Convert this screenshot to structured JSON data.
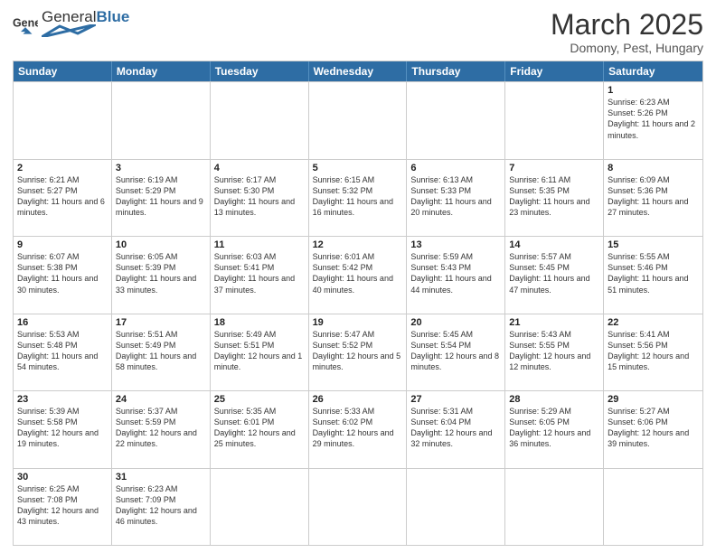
{
  "header": {
    "logo_general": "General",
    "logo_blue": "Blue",
    "month_title": "March 2025",
    "location": "Domony, Pest, Hungary"
  },
  "weekdays": [
    "Sunday",
    "Monday",
    "Tuesday",
    "Wednesday",
    "Thursday",
    "Friday",
    "Saturday"
  ],
  "weeks": [
    [
      {
        "day": "",
        "info": ""
      },
      {
        "day": "",
        "info": ""
      },
      {
        "day": "",
        "info": ""
      },
      {
        "day": "",
        "info": ""
      },
      {
        "day": "",
        "info": ""
      },
      {
        "day": "",
        "info": ""
      },
      {
        "day": "1",
        "info": "Sunrise: 6:23 AM\nSunset: 5:26 PM\nDaylight: 11 hours and 2 minutes."
      }
    ],
    [
      {
        "day": "2",
        "info": "Sunrise: 6:21 AM\nSunset: 5:27 PM\nDaylight: 11 hours and 6 minutes."
      },
      {
        "day": "3",
        "info": "Sunrise: 6:19 AM\nSunset: 5:29 PM\nDaylight: 11 hours and 9 minutes."
      },
      {
        "day": "4",
        "info": "Sunrise: 6:17 AM\nSunset: 5:30 PM\nDaylight: 11 hours and 13 minutes."
      },
      {
        "day": "5",
        "info": "Sunrise: 6:15 AM\nSunset: 5:32 PM\nDaylight: 11 hours and 16 minutes."
      },
      {
        "day": "6",
        "info": "Sunrise: 6:13 AM\nSunset: 5:33 PM\nDaylight: 11 hours and 20 minutes."
      },
      {
        "day": "7",
        "info": "Sunrise: 6:11 AM\nSunset: 5:35 PM\nDaylight: 11 hours and 23 minutes."
      },
      {
        "day": "8",
        "info": "Sunrise: 6:09 AM\nSunset: 5:36 PM\nDaylight: 11 hours and 27 minutes."
      }
    ],
    [
      {
        "day": "9",
        "info": "Sunrise: 6:07 AM\nSunset: 5:38 PM\nDaylight: 11 hours and 30 minutes."
      },
      {
        "day": "10",
        "info": "Sunrise: 6:05 AM\nSunset: 5:39 PM\nDaylight: 11 hours and 33 minutes."
      },
      {
        "day": "11",
        "info": "Sunrise: 6:03 AM\nSunset: 5:41 PM\nDaylight: 11 hours and 37 minutes."
      },
      {
        "day": "12",
        "info": "Sunrise: 6:01 AM\nSunset: 5:42 PM\nDaylight: 11 hours and 40 minutes."
      },
      {
        "day": "13",
        "info": "Sunrise: 5:59 AM\nSunset: 5:43 PM\nDaylight: 11 hours and 44 minutes."
      },
      {
        "day": "14",
        "info": "Sunrise: 5:57 AM\nSunset: 5:45 PM\nDaylight: 11 hours and 47 minutes."
      },
      {
        "day": "15",
        "info": "Sunrise: 5:55 AM\nSunset: 5:46 PM\nDaylight: 11 hours and 51 minutes."
      }
    ],
    [
      {
        "day": "16",
        "info": "Sunrise: 5:53 AM\nSunset: 5:48 PM\nDaylight: 11 hours and 54 minutes."
      },
      {
        "day": "17",
        "info": "Sunrise: 5:51 AM\nSunset: 5:49 PM\nDaylight: 11 hours and 58 minutes."
      },
      {
        "day": "18",
        "info": "Sunrise: 5:49 AM\nSunset: 5:51 PM\nDaylight: 12 hours and 1 minute."
      },
      {
        "day": "19",
        "info": "Sunrise: 5:47 AM\nSunset: 5:52 PM\nDaylight: 12 hours and 5 minutes."
      },
      {
        "day": "20",
        "info": "Sunrise: 5:45 AM\nSunset: 5:54 PM\nDaylight: 12 hours and 8 minutes."
      },
      {
        "day": "21",
        "info": "Sunrise: 5:43 AM\nSunset: 5:55 PM\nDaylight: 12 hours and 12 minutes."
      },
      {
        "day": "22",
        "info": "Sunrise: 5:41 AM\nSunset: 5:56 PM\nDaylight: 12 hours and 15 minutes."
      }
    ],
    [
      {
        "day": "23",
        "info": "Sunrise: 5:39 AM\nSunset: 5:58 PM\nDaylight: 12 hours and 19 minutes."
      },
      {
        "day": "24",
        "info": "Sunrise: 5:37 AM\nSunset: 5:59 PM\nDaylight: 12 hours and 22 minutes."
      },
      {
        "day": "25",
        "info": "Sunrise: 5:35 AM\nSunset: 6:01 PM\nDaylight: 12 hours and 25 minutes."
      },
      {
        "day": "26",
        "info": "Sunrise: 5:33 AM\nSunset: 6:02 PM\nDaylight: 12 hours and 29 minutes."
      },
      {
        "day": "27",
        "info": "Sunrise: 5:31 AM\nSunset: 6:04 PM\nDaylight: 12 hours and 32 minutes."
      },
      {
        "day": "28",
        "info": "Sunrise: 5:29 AM\nSunset: 6:05 PM\nDaylight: 12 hours and 36 minutes."
      },
      {
        "day": "29",
        "info": "Sunrise: 5:27 AM\nSunset: 6:06 PM\nDaylight: 12 hours and 39 minutes."
      }
    ],
    [
      {
        "day": "30",
        "info": "Sunrise: 6:25 AM\nSunset: 7:08 PM\nDaylight: 12 hours and 43 minutes."
      },
      {
        "day": "31",
        "info": "Sunrise: 6:23 AM\nSunset: 7:09 PM\nDaylight: 12 hours and 46 minutes."
      },
      {
        "day": "",
        "info": ""
      },
      {
        "day": "",
        "info": ""
      },
      {
        "day": "",
        "info": ""
      },
      {
        "day": "",
        "info": ""
      },
      {
        "day": "",
        "info": ""
      }
    ]
  ]
}
